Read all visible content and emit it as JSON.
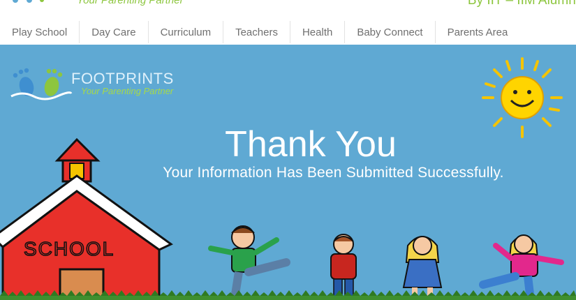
{
  "header": {
    "tagline": "Your Parenting Partner",
    "alumni_text": "By IIT – IIM Alumni"
  },
  "nav": {
    "items": [
      {
        "label": "Play School"
      },
      {
        "label": "Day Care"
      },
      {
        "label": "Curriculum"
      },
      {
        "label": "Teachers"
      },
      {
        "label": "Health"
      },
      {
        "label": "Baby Connect"
      },
      {
        "label": "Parents Area"
      }
    ]
  },
  "banner": {
    "brand_name": "FOOTPRINTS",
    "brand_tagline": "Your Parenting Partner",
    "title": "Thank You",
    "subtitle": "Your Information Has Been Submitted Successfully.",
    "school_sign": "SCHOOL",
    "icons": [
      "footprints-logo-icon",
      "sun-icon",
      "school-house-icon",
      "child-figure-icon"
    ]
  },
  "colors": {
    "banner_bg": "#5fa9d3",
    "brand_green": "#8dc63f",
    "nav_text": "#6f6f6f",
    "school_red": "#e8302a"
  }
}
